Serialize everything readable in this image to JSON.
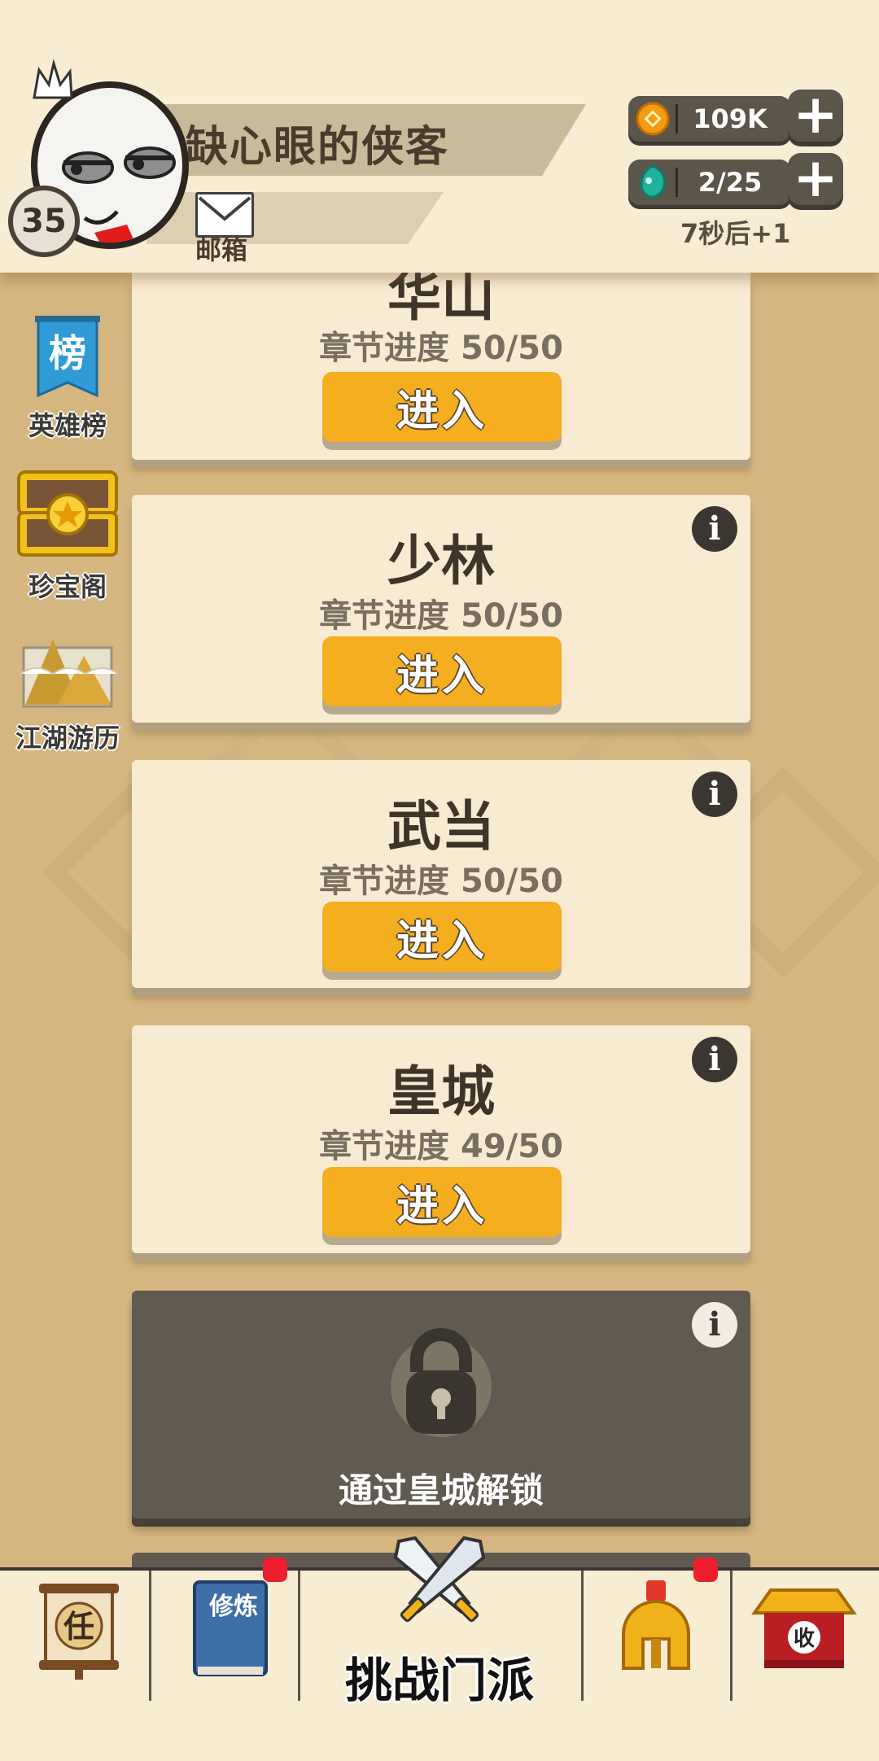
{
  "colors": {
    "background": "#d6b680",
    "header_bg": "#f8ecd2",
    "card_bg": "#f9ebd2",
    "button_orange": "#f5ae1f",
    "locked_card": "#605a50",
    "badge_red": "#ef1e2c"
  },
  "header": {
    "player_name": "缺心眼的侠客",
    "level": "35",
    "mail_label": "邮箱",
    "coins": {
      "icon": "coin-icon",
      "value": "109K"
    },
    "energy": {
      "icon": "energy-drop-icon",
      "value": "2/25"
    },
    "regen_text": "7秒后+1",
    "add_coins_label": "+",
    "add_energy_label": "+"
  },
  "side_nav": [
    {
      "label": "英雄榜",
      "icon": "leaderboard-banner-icon",
      "icon_char": "榜"
    },
    {
      "label": "珍宝阁",
      "icon": "treasure-chest-icon"
    },
    {
      "label": "江湖游历",
      "icon": "mountain-scroll-icon"
    }
  ],
  "sects": [
    {
      "name": "华山",
      "progress": "章节进度 50/50",
      "button": "进入"
    },
    {
      "name": "少林",
      "progress": "章节进度 50/50",
      "button": "进入"
    },
    {
      "name": "武当",
      "progress": "章节进度 50/50",
      "button": "进入"
    },
    {
      "name": "皇城",
      "progress": "章节进度 49/50",
      "button": "进入"
    },
    {
      "name": "",
      "locked_text": "通过皇城解锁",
      "locked": true
    }
  ],
  "info_icon_char": "i",
  "bottom_nav": [
    {
      "icon": "quest-scroll-icon",
      "icon_char": "任",
      "badge": false
    },
    {
      "icon": "training-book-icon",
      "icon_char": "修炼",
      "badge": true
    },
    {
      "label": "挑战门派",
      "icon": "crossed-swords-icon",
      "badge": false
    },
    {
      "icon": "helmet-icon",
      "badge": true
    },
    {
      "icon": "collection-shop-icon",
      "icon_char": "收",
      "badge": false
    }
  ]
}
